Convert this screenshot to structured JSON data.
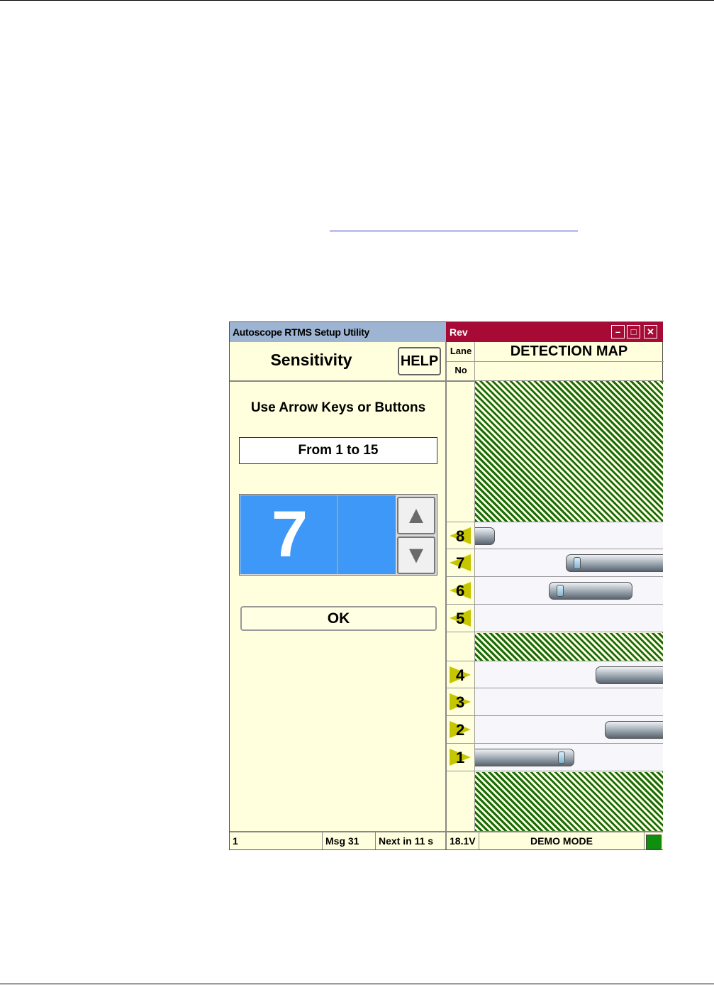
{
  "window": {
    "app_title": "Autoscope RTMS Setup Utility",
    "direction_label": "Rev",
    "minimize": "–",
    "maximize": "□",
    "close": "✕"
  },
  "panel": {
    "title": "Sensitivity",
    "help_label": "HELP",
    "instruction": "Use Arrow Keys or Buttons",
    "range": "From 1 to 15",
    "value": "7",
    "ok_label": "OK"
  },
  "map": {
    "lane_header": "Lane",
    "no_header": "No",
    "title": "DETECTION MAP",
    "lanes": [
      {
        "label": "8",
        "direction": "left",
        "vehicles": 1
      },
      {
        "label": "7",
        "direction": "left",
        "vehicles": 1
      },
      {
        "label": "6",
        "direction": "left",
        "vehicles": 1
      },
      {
        "label": "5",
        "direction": "left",
        "vehicles": 0
      },
      {
        "label": "4",
        "direction": "right",
        "vehicles": 1
      },
      {
        "label": "3",
        "direction": "right",
        "vehicles": 0
      },
      {
        "label": "2",
        "direction": "right",
        "vehicles": 1
      },
      {
        "label": "1",
        "direction": "right",
        "vehicles": 1
      }
    ],
    "hatch_color": "#1a6b0a",
    "lane_arrow_color": "#c6c600"
  },
  "status": {
    "sensor": "1",
    "msg": "Msg 31",
    "next": "Next in 11 s",
    "voltage": "18.1V",
    "mode": "DEMO MODE",
    "led_color": "#0e8f0e"
  },
  "colors": {
    "title_left_bg": "#9db4d2",
    "title_right_bg": "#a60a35",
    "value_bg": "#3d98f7",
    "panel_bg": "#ffffdd"
  }
}
